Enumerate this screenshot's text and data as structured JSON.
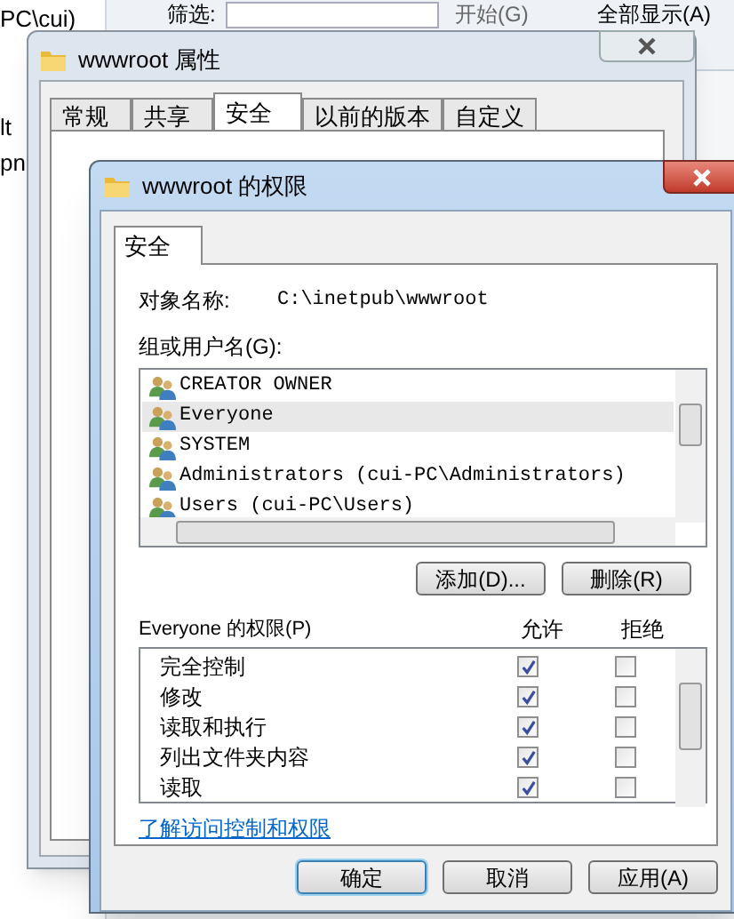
{
  "background": {
    "side_texts": [
      "PC\\cui)",
      "lt",
      "pn"
    ],
    "toolbar": {
      "filter_label": "筛选:",
      "start_button": "开始(G)",
      "show_all_button": "全部显示(A)"
    }
  },
  "properties_window": {
    "title": "wwwroot 属性",
    "tabs": [
      {
        "label": "常规",
        "selected": false
      },
      {
        "label": "共享",
        "selected": false
      },
      {
        "label": "安全",
        "selected": true
      },
      {
        "label": "以前的版本",
        "selected": false
      },
      {
        "label": "自定义",
        "selected": false
      }
    ]
  },
  "permissions_dialog": {
    "title": "wwwroot 的权限",
    "tabs": [
      {
        "label": "安全",
        "selected": true
      }
    ],
    "object_name_label": "对象名称:",
    "object_name": "C:\\inetpub\\wwwroot",
    "groups_label": "组或用户名(G):",
    "groups": [
      {
        "name": "CREATOR OWNER",
        "selected": false
      },
      {
        "name": "Everyone",
        "selected": true
      },
      {
        "name": "SYSTEM",
        "selected": false
      },
      {
        "name": "Administrators (cui-PC\\Administrators)",
        "selected": false
      },
      {
        "name": "Users (cui-PC\\Users)",
        "selected": false
      }
    ],
    "add_button": "添加(D)...",
    "remove_button": "删除(R)",
    "permissions_label": "Everyone 的权限(P)",
    "allow_header": "允许",
    "deny_header": "拒绝",
    "permissions": [
      {
        "name": "完全控制",
        "allow": true,
        "deny": false
      },
      {
        "name": "修改",
        "allow": true,
        "deny": false
      },
      {
        "name": "读取和执行",
        "allow": true,
        "deny": false
      },
      {
        "name": "列出文件夹内容",
        "allow": true,
        "deny": false
      },
      {
        "name": "读取",
        "allow": true,
        "deny": false
      }
    ],
    "help_link": "了解访问控制和权限",
    "buttons": [
      {
        "label": "确定",
        "default": true
      },
      {
        "label": "取消",
        "default": false
      },
      {
        "label": "应用(A)",
        "default": false
      }
    ]
  }
}
